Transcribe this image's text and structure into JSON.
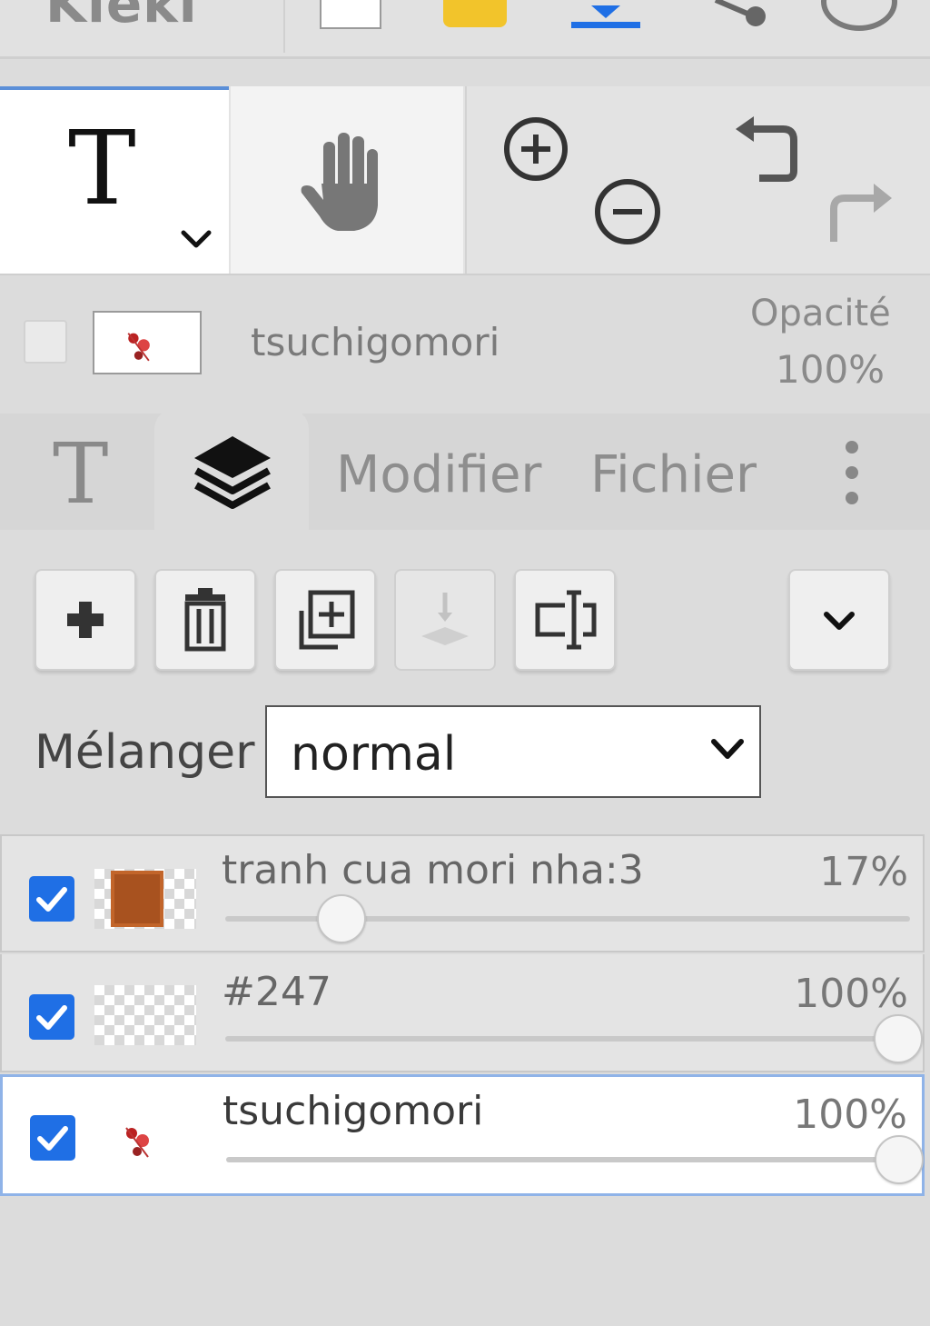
{
  "app": {
    "logo_text": "Kleki"
  },
  "colors": {
    "accent": "#1f6fe5",
    "selected_border": "#8fb3e8",
    "folder": "#f2c42b"
  },
  "topbar": {
    "icons": [
      "color-swatch",
      "folder-icon",
      "download-icon",
      "share-icon",
      "help-icon"
    ]
  },
  "tools": {
    "text_glyph": "T",
    "hand": "hand-icon",
    "zoom_in": "zoom-in-icon",
    "zoom_out": "zoom-out-icon",
    "undo": "undo-icon",
    "redo": "redo-icon"
  },
  "preview": {
    "layer_name": "tsuchigomori",
    "opacity_label": "Opacité",
    "opacity_value": "100%"
  },
  "tabs": {
    "text_glyph": "T",
    "layers": "layers-icon",
    "modifier": "Modifier",
    "file": "Fichier",
    "more": "more-vertical-icon"
  },
  "layer_actions": [
    "add-icon",
    "trash-icon",
    "duplicate-icon",
    "merge-down-icon",
    "rename-icon",
    "chevron-down-icon"
  ],
  "blend": {
    "label": "Mélanger",
    "value": "normal"
  },
  "layers": [
    {
      "name": "tranh cua mori nha:3",
      "opacity_label": "17%",
      "opacity": 0.17,
      "visible": true
    },
    {
      "name": "#247",
      "opacity_label": "100%",
      "opacity": 1.0,
      "visible": true
    },
    {
      "name": "tsuchigomori",
      "opacity_label": "100%",
      "opacity": 1.0,
      "visible": true,
      "selected": true
    }
  ]
}
